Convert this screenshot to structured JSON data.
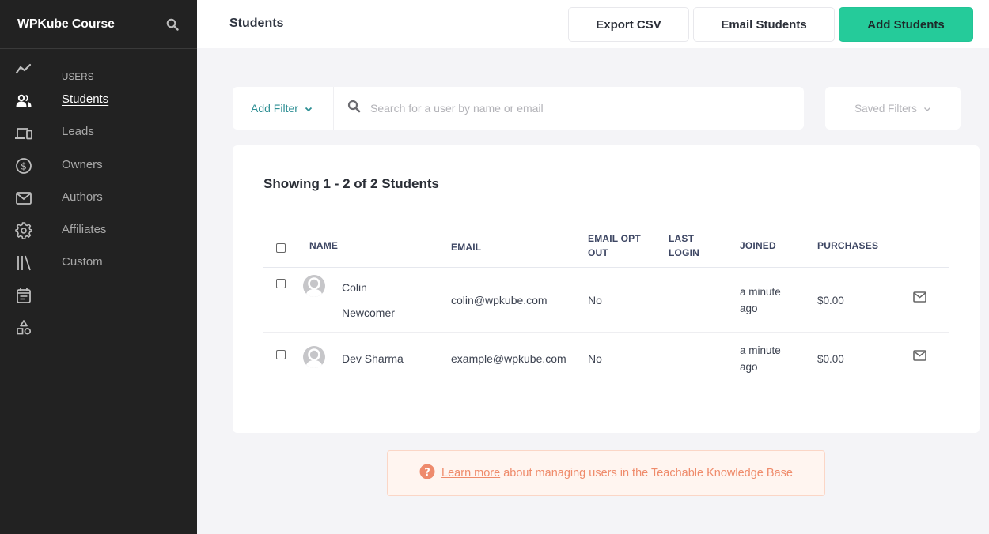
{
  "sidebar": {
    "brand": "WPKube Course",
    "rail_icons": [
      "analytics-icon",
      "users-icon",
      "devices-icon",
      "dollar-icon",
      "mail-icon",
      "gear-icon",
      "library-icon",
      "calendar-icon",
      "shapes-icon"
    ],
    "section_heading": "USERS",
    "items": [
      {
        "label": "Students",
        "active": true
      },
      {
        "label": "Leads",
        "active": false
      },
      {
        "label": "Owners",
        "active": false
      },
      {
        "label": "Authors",
        "active": false
      },
      {
        "label": "Affiliates",
        "active": false
      },
      {
        "label": "Custom",
        "active": false
      }
    ]
  },
  "header": {
    "title": "Students",
    "buttons": {
      "export": "Export CSV",
      "email": "Email Students",
      "add": "Add Students"
    }
  },
  "filters": {
    "add_filter_label": "Add Filter",
    "search_placeholder": "Search for a user by name or email",
    "search_value": "",
    "saved_filters_label": "Saved Filters"
  },
  "results": {
    "summary": "Showing 1 - 2 of 2 Students",
    "columns": {
      "name": "NAME",
      "email": "EMAIL",
      "email_opt_out_1": "EMAIL OPT",
      "email_opt_out_2": "OUT",
      "last_login_1": "LAST",
      "last_login_2": "LOGIN",
      "joined": "JOINED",
      "purchases": "PURCHASES"
    },
    "rows": [
      {
        "name_line1": "Colin",
        "name_line2": "Newcomer",
        "email": "colin@wpkube.com",
        "email_opt_out": "No",
        "last_login": "",
        "joined_1": "a minute",
        "joined_2": "ago",
        "purchases": "$0.00"
      },
      {
        "name": "Dev Sharma",
        "email": "example@wpkube.com",
        "email_opt_out": "No",
        "last_login": "",
        "joined_1": "a minute",
        "joined_2": "ago",
        "purchases": "$0.00"
      }
    ]
  },
  "help": {
    "link_text": "Learn more",
    "text": "about managing users in the Teachable Knowledge Base"
  },
  "colors": {
    "primary": "#25cb9a",
    "sidebar_bg": "#222222",
    "filter_accent": "#2e8f94",
    "help_text": "#ef8b6b"
  }
}
